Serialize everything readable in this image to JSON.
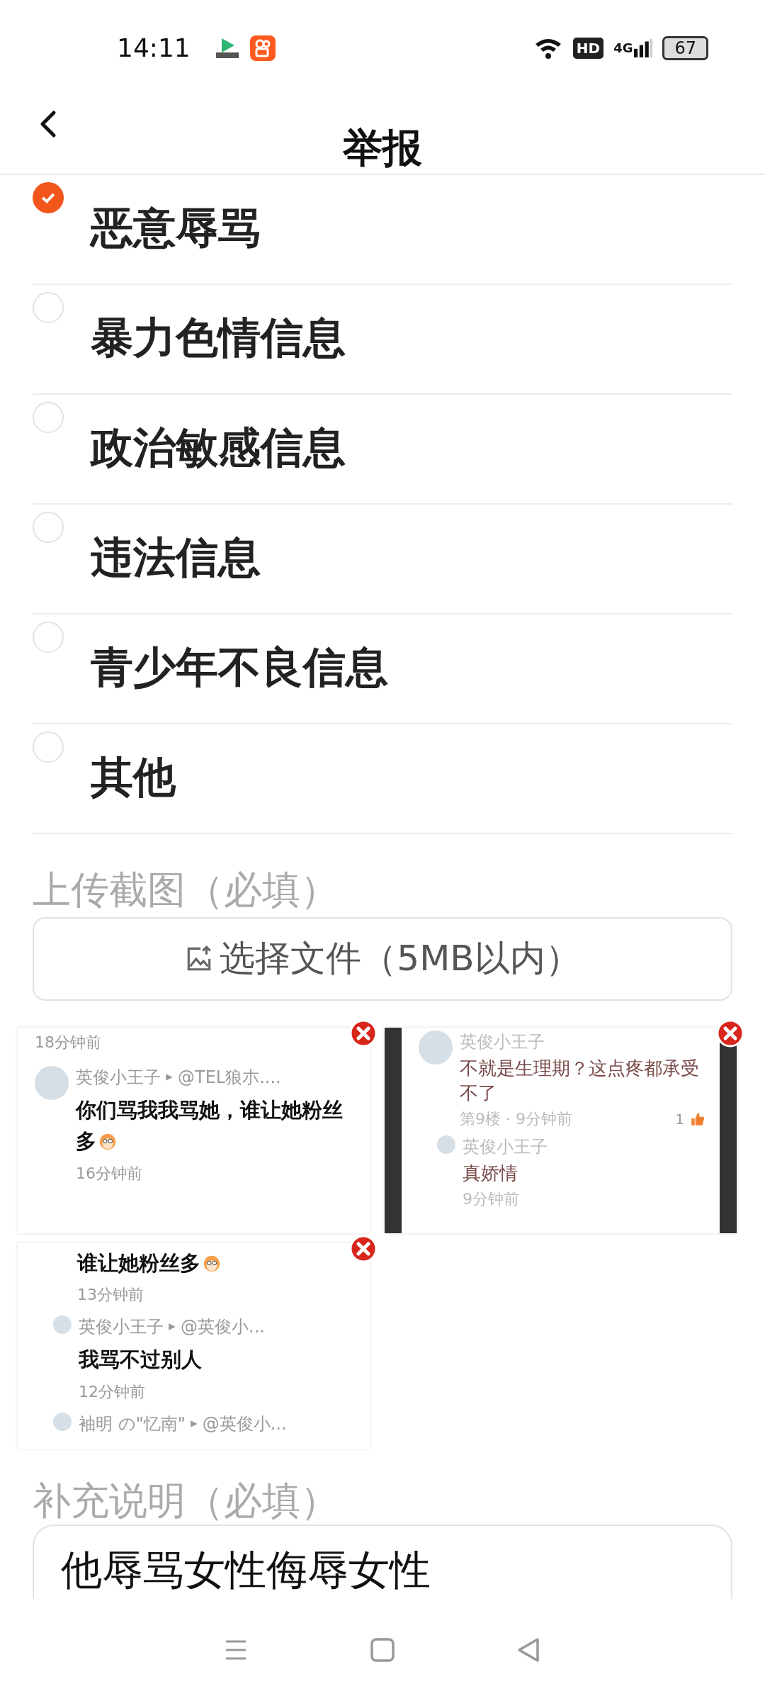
{
  "status_bar": {
    "time": "14:11",
    "network": "4G",
    "hd": "HD",
    "battery": "67"
  },
  "header": {
    "title": "举报"
  },
  "reasons": [
    {
      "label": "恶意辱骂",
      "selected": true
    },
    {
      "label": "暴力色情信息",
      "selected": false
    },
    {
      "label": "政治敏感信息",
      "selected": false
    },
    {
      "label": "违法信息",
      "selected": false
    },
    {
      "label": "青少年不良信息",
      "selected": false
    },
    {
      "label": "其他",
      "selected": false
    }
  ],
  "upload": {
    "label": "上传截图（必填）",
    "button": "选择文件（5MB以内）"
  },
  "screenshots": [
    {
      "kind": "light",
      "comments": [
        {
          "time": "18分钟前",
          "reply": false
        },
        {
          "user": "英俊小王子",
          "reply_to": "@TEL狼朩....",
          "text": "你们骂我我骂她，谁让她粉丝多",
          "emoji": true,
          "time": "16分钟前",
          "reply": false
        }
      ]
    },
    {
      "kind": "framed",
      "comments": [
        {
          "user": "英俊小王子",
          "text": "不就是生理期？这点疼都承受不了",
          "time": "第9楼 · 9分钟前",
          "likes": "1",
          "reply": false
        },
        {
          "user": "英俊小王子",
          "text": "真娇情",
          "time": "9分钟前",
          "reply": true
        }
      ]
    },
    {
      "kind": "light",
      "comments": [
        {
          "text": "谁让她粉丝多",
          "emoji": true,
          "time": "13分钟前",
          "reply": true
        },
        {
          "user": "英俊小王子",
          "reply_to": "@英俊小...",
          "text": "我骂不过别人",
          "time": "12分钟前",
          "reply": true
        },
        {
          "user": "袖明 の\"忆南\"",
          "reply_to": "@英俊小...",
          "reply": true
        }
      ]
    }
  ],
  "note": {
    "label": "补充说明（必填）",
    "value": "他辱骂女性侮辱女性"
  }
}
